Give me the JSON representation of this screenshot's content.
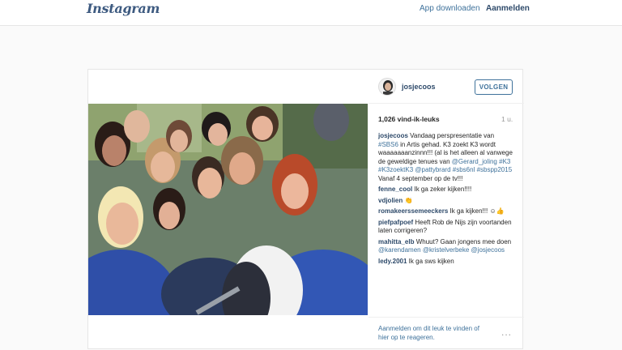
{
  "header": {
    "logo": "Instagram",
    "app_download": "App downloaden",
    "login": "Aanmelden"
  },
  "post": {
    "username": "josjecoos",
    "follow_label": "VOLGEN",
    "likes": "1,026 vind-ik-leuks",
    "age": "1 u.",
    "caption": {
      "user": "josjecoos",
      "t1": "Vandaag perspresentatie van ",
      "tag1": "#SBS6",
      "t2": " in Artis gehad. K3 zoekt K3 wordt waaaaaaanzinnn!!! (al is het alleen al vanwege de geweldige tenues van ",
      "mention1": "@Gerard_joling",
      "t3": " ",
      "tag2": "#K3",
      "t4": " ",
      "tag3": "#K3zoektK3",
      "t5": " ",
      "mention2": "@pattybrard",
      "t6": " ",
      "tag4": "#sbs6nl",
      "t7": " ",
      "tag5": "#sbspp2015",
      "t8": " Vanaf 4 september op de tv!!!"
    },
    "comments": [
      {
        "user": "fenne_cool",
        "text": "Ik ga zeker kijken!!!!"
      },
      {
        "user": "vdjolien",
        "text": "👏"
      },
      {
        "user": "romakeerssemeeckers",
        "text": "Ik ga kijken!!! ☺👍"
      },
      {
        "user": "piefpafpoef",
        "text": "Heeft Rob de Nijs zijn voortanden laten corrigeren?"
      },
      {
        "user": "mahitta_elb",
        "text": "Whuut? Gaan jongens mee doen ",
        "m1": "@karendamen",
        "m2": "@kristelverbeke",
        "m3": "@josjecoos"
      },
      {
        "user": "ledy.2001",
        "text": "Ik ga sws kijken"
      }
    ],
    "login_prompt": "Aanmelden om dit leuk te vinden of hier op te reageren.",
    "more_icon": "..."
  },
  "colors": {
    "link": "#3f729b",
    "username": "#2e4a6a",
    "background": "#fafafa"
  }
}
